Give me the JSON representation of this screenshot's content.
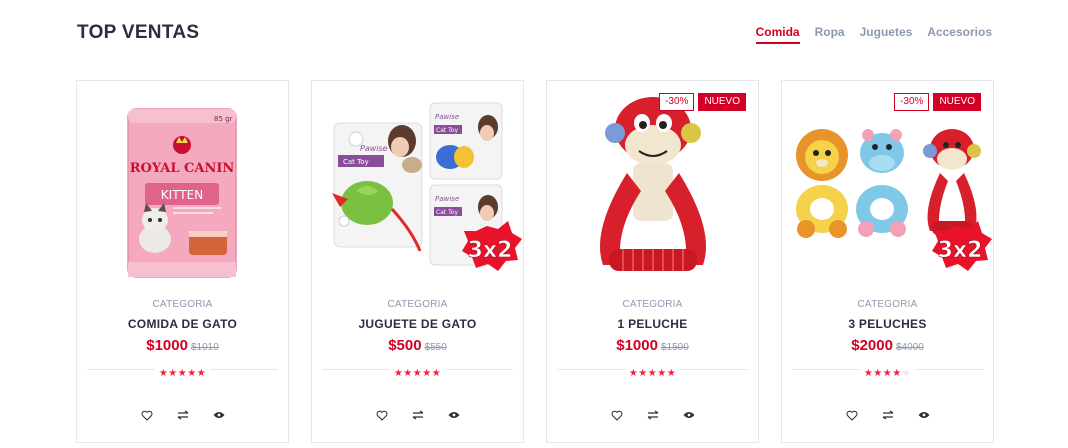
{
  "section": {
    "title": "TOP VENTAS"
  },
  "tabs": [
    "Comida",
    "Ropa",
    "Juguetes",
    "Accesorios"
  ],
  "active_tab": "Comida",
  "products": [
    {
      "category": "CATEGORIA",
      "name": "COMIDA DE GATO",
      "price": "$1000",
      "old_price": "$1010",
      "rating": 5,
      "labels": [],
      "image": "royal-canin-kitten-pouch"
    },
    {
      "category": "CATEGORIA",
      "name": "JUGUETE DE GATO",
      "price": "$500",
      "old_price": "$550",
      "rating": 5,
      "labels": [],
      "image": "pawise-cat-toy",
      "promo": "3x2"
    },
    {
      "category": "CATEGORIA",
      "name": "1 PELUCHE",
      "price": "$1000",
      "old_price": "$1500",
      "rating": 5,
      "labels": [
        "-30%",
        "NUEVO"
      ],
      "image": "monkey-plush-toy"
    },
    {
      "category": "CATEGORIA",
      "name": "3 PELUCHES",
      "price": "$2000",
      "old_price": "$4000",
      "rating": 4,
      "labels": [
        "-30%",
        "NUEVO"
      ],
      "image": "three-plush-toys",
      "promo": "3x2"
    }
  ],
  "product_actions": [
    "heart-icon",
    "exchange-icon",
    "eye-icon"
  ],
  "colors": {
    "accent": "#d10024",
    "text": "#2b2d42",
    "muted": "#8d99ae",
    "border": "#e4e7ed",
    "star": "#ef233c"
  }
}
